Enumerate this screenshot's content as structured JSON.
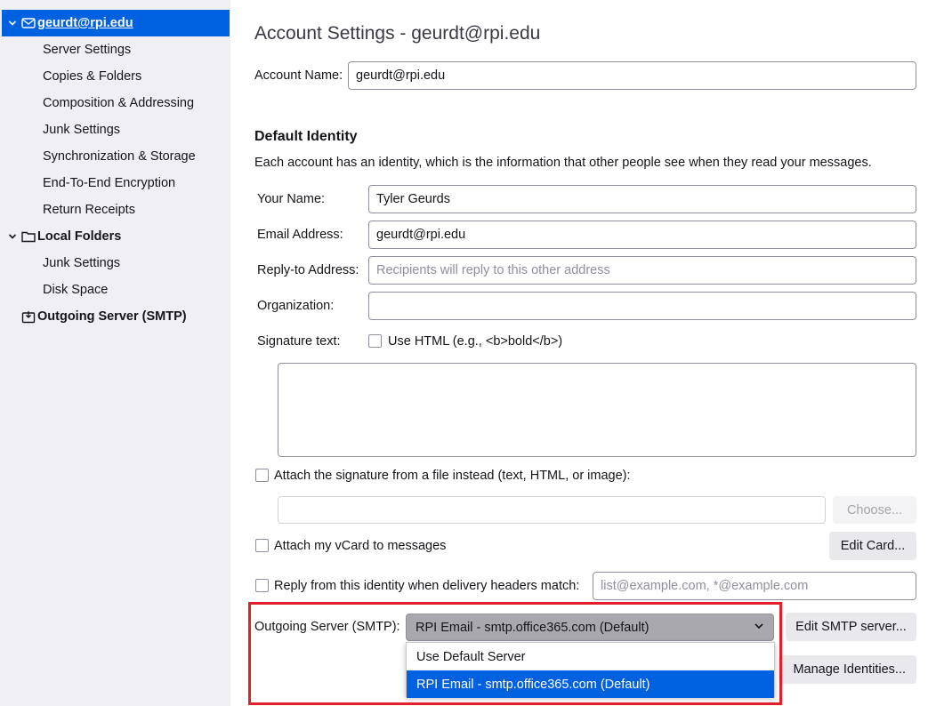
{
  "sidebar": {
    "account": {
      "label": "geurdt@rpi.edu",
      "icon": "envelope-icon"
    },
    "account_items": [
      {
        "label": "Server Settings"
      },
      {
        "label": "Copies & Folders"
      },
      {
        "label": "Composition & Addressing"
      },
      {
        "label": "Junk Settings"
      },
      {
        "label": "Synchronization & Storage"
      },
      {
        "label": "End-To-End Encryption"
      },
      {
        "label": "Return Receipts"
      }
    ],
    "local_folders": {
      "label": "Local Folders",
      "icon": "folder-icon"
    },
    "local_items": [
      {
        "label": "Junk Settings"
      },
      {
        "label": "Disk Space"
      }
    ],
    "outgoing": {
      "label": "Outgoing Server (SMTP)",
      "icon": "outbox-icon"
    }
  },
  "main": {
    "title": "Account Settings - geurdt@rpi.edu",
    "account_name_label": "Account Name:",
    "account_name_value": "geurdt@rpi.edu",
    "default_identity_heading": "Default Identity",
    "default_identity_desc": "Each account has an identity, which is the information that other people see when they read your messages.",
    "your_name_label": "Your Name:",
    "your_name_value": "Tyler Geurds",
    "email_label": "Email Address:",
    "email_value": "geurdt@rpi.edu",
    "reply_to_label": "Reply-to Address:",
    "reply_to_placeholder": "Recipients will reply to this other address",
    "organization_label": "Organization:",
    "organization_value": "",
    "signature_label": "Signature text:",
    "use_html_label": "Use HTML (e.g., <b>bold</b>)",
    "attach_sig_label": "Attach the signature from a file instead (text, HTML, or image):",
    "choose_button": "Choose...",
    "attach_vcard_label": "Attach my vCard to messages",
    "edit_card_button": "Edit Card...",
    "reply_from_label": "Reply from this identity when delivery headers match:",
    "reply_from_placeholder": "list@example.com, *@example.com",
    "outgoing_label": "Outgoing Server (SMTP):",
    "outgoing_selected": "RPI Email - smtp.office365.com (Default)",
    "outgoing_options": [
      "Use Default Server",
      "RPI Email - smtp.office365.com (Default)"
    ],
    "edit_smtp_button": "Edit SMTP server...",
    "manage_identities_button": "Manage Identities..."
  },
  "colors": {
    "selection": "#0061e0",
    "highlight": "#e0202a",
    "sidebar_bg": "#f0f0f4"
  }
}
